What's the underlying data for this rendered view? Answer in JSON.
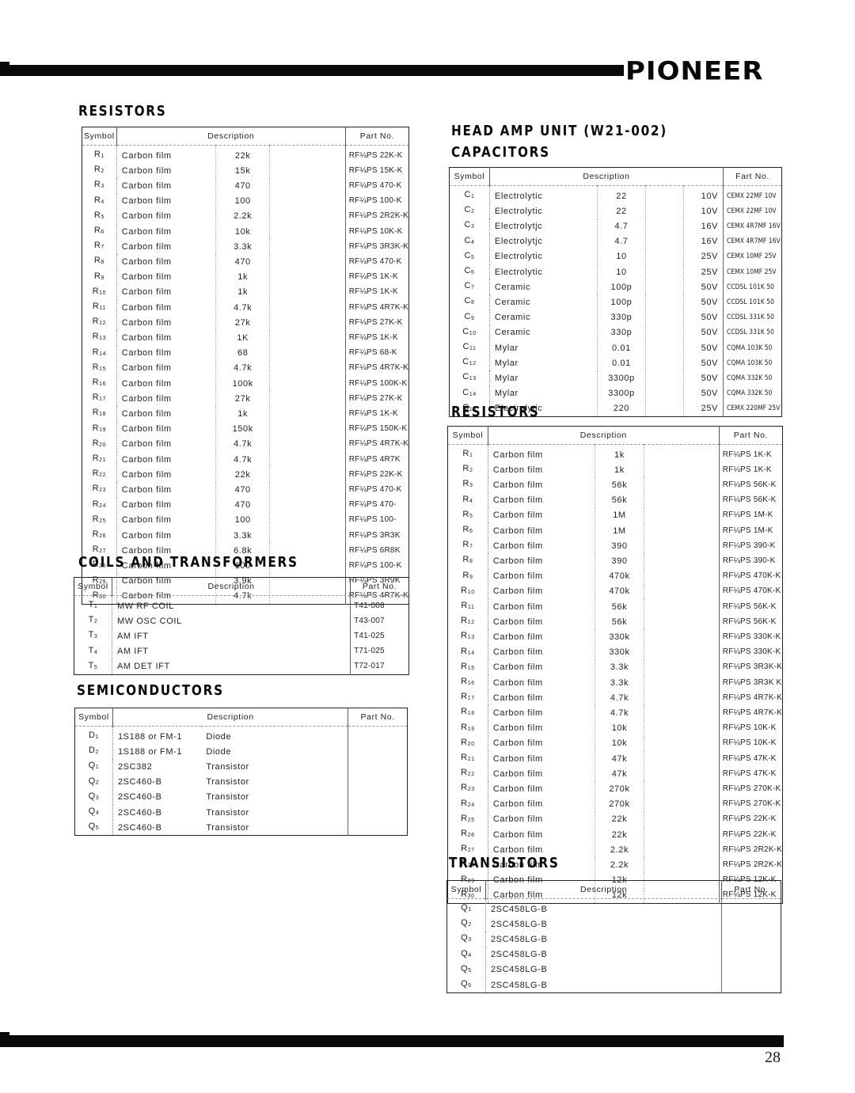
{
  "header": {
    "brand": "PIONEER"
  },
  "footer": {
    "page_number": "28"
  },
  "left": {
    "resistors": {
      "title": "RESISTORS",
      "columns": [
        "Symbol",
        "Description",
        "Part No."
      ],
      "rows": [
        {
          "sym": "R",
          "n": "1",
          "desc": "Carbon film",
          "val": "22k",
          "part": "RF¼PS 22K-K"
        },
        {
          "sym": "R",
          "n": "2",
          "desc": "Carbon film",
          "val": "15k",
          "part": "RF¼PS 15K-K"
        },
        {
          "sym": "R",
          "n": "3",
          "desc": "Carbon film",
          "val": "470",
          "part": "RF¼PS 470-K"
        },
        {
          "sym": "R",
          "n": "4",
          "desc": "Carbon film",
          "val": "100",
          "part": "RF¼PS 100-K"
        },
        {
          "sym": "R",
          "n": "5",
          "desc": "Carbon film",
          "val": "2.2k",
          "part": "RF¼PS 2R2K-K"
        },
        {
          "sym": "R",
          "n": "6",
          "desc": "Carbon film",
          "val": "10k",
          "part": "RF¼PS 10K-K"
        },
        {
          "sym": "R",
          "n": "7",
          "desc": "Carbon film",
          "val": "3.3k",
          "part": "RF¼PS 3R3K-K"
        },
        {
          "sym": "R",
          "n": "8",
          "desc": "Carbon film",
          "val": "470",
          "part": "RF¼PS 470-K"
        },
        {
          "sym": "R",
          "n": "9",
          "desc": "Carbon film",
          "val": "1k",
          "part": "RF¼PS 1K-K"
        },
        {
          "sym": "R",
          "n": "10",
          "desc": "Carbon film",
          "val": "1k",
          "part": "RF¼PS 1K-K"
        },
        {
          "sym": "R",
          "n": "11",
          "desc": "Carbon film",
          "val": "4.7k",
          "part": "RF¼PS 4R7K-K"
        },
        {
          "sym": "R",
          "n": "12",
          "desc": "Carbon film",
          "val": "27k",
          "part": "RF¼PS 27K-K"
        },
        {
          "sym": "R",
          "n": "13",
          "desc": "Carbon film",
          "val": "1K",
          "part": "RF¼PS 1K-K"
        },
        {
          "sym": "R",
          "n": "14",
          "desc": "Carbon film",
          "val": "68",
          "part": "RF¼PS 68-K"
        },
        {
          "sym": "R",
          "n": "15",
          "desc": "Carbon film",
          "val": "4.7k",
          "part": "RF¼PS 4R7K-K"
        },
        {
          "sym": "R",
          "n": "16",
          "desc": "Carbon film",
          "val": "100k",
          "part": "RF¼PS 100K-K"
        },
        {
          "sym": "R",
          "n": "17",
          "desc": "Carbon film",
          "val": "27k",
          "part": "RF¼PS 27K-K"
        },
        {
          "sym": "R",
          "n": "18",
          "desc": "Carbon film",
          "val": "1k",
          "part": "RF¼PS 1K-K"
        },
        {
          "sym": "R",
          "n": "19",
          "desc": "Carbon film",
          "val": "150k",
          "part": "RF¼PS 150K-K"
        },
        {
          "sym": "R",
          "n": "20",
          "desc": "Carbon film",
          "val": "4.7k",
          "part": "RF¼PS 4R7K-K"
        },
        {
          "sym": "R",
          "n": "21",
          "desc": "Carbon film",
          "val": "4.7k",
          "part": "RF¼PS 4R7K"
        },
        {
          "sym": "R",
          "n": "22",
          "desc": "Carbon film",
          "val": "22k",
          "part": "RF¼PS 22K-K"
        },
        {
          "sym": "R",
          "n": "23",
          "desc": "Carbon film",
          "val": "470",
          "part": "RF¼PS 470-K"
        },
        {
          "sym": "R",
          "n": "24",
          "desc": "Carbon film",
          "val": "470",
          "part": "RF¼PS 470-"
        },
        {
          "sym": "R",
          "n": "25",
          "desc": "Carbon film",
          "val": "100",
          "part": "RF¼PS 100-"
        },
        {
          "sym": "R",
          "n": "26",
          "desc": "Carbon film",
          "val": "3.3k",
          "part": "RF¼PS 3R3K"
        },
        {
          "sym": "R",
          "n": "27",
          "desc": "Carbon film",
          "val": "6.8k",
          "part": "RF¼PS 6R8K"
        },
        {
          "sym": "R",
          "n": "28",
          "desc": "Carbon film",
          "val": "100",
          "part": "RF¼PS 100-K"
        },
        {
          "sym": "R",
          "n": "29",
          "desc": "Carbon film",
          "val": "3.9k",
          "part": "RF¼PS 3R9K"
        },
        {
          "sym": "R",
          "n": "30",
          "desc": "Carbon film",
          "val": "4.7k",
          "part": "RF¼PS 4R7K-K"
        }
      ]
    },
    "coils": {
      "title": "COILS AND TRANSFORMERS",
      "columns": [
        "Symbol",
        "Description",
        "Part No."
      ],
      "rows": [
        {
          "sym": "T",
          "n": "1",
          "desc": "MW RF COIL",
          "part": "T41-008"
        },
        {
          "sym": "T",
          "n": "2",
          "desc": "MW OSC COIL",
          "part": "T43-007"
        },
        {
          "sym": "T",
          "n": "3",
          "desc": "AM IFT",
          "part": "T41-025"
        },
        {
          "sym": "T",
          "n": "4",
          "desc": "AM IFT",
          "part": "T71-025"
        },
        {
          "sym": "T",
          "n": "5",
          "desc": "AM DET IFT",
          "part": "T72-017"
        }
      ]
    },
    "semiconductors": {
      "title": "SEMICONDUCTORS",
      "columns": [
        "Symbol",
        "Description",
        "Part No."
      ],
      "rows": [
        {
          "sym": "D",
          "n": "1",
          "desc": "1S188 or FM-1",
          "type": "Diode",
          "part": ""
        },
        {
          "sym": "D",
          "n": "2",
          "desc": "1S188 or FM-1",
          "type": "Diode",
          "part": ""
        },
        {
          "sym": "Q",
          "n": "1",
          "desc": "2SC382",
          "type": "Transistor",
          "part": ""
        },
        {
          "sym": "Q",
          "n": "2",
          "desc": "2SC460-B",
          "type": "Transistor",
          "part": ""
        },
        {
          "sym": "Q",
          "n": "3",
          "desc": "2SC460-B",
          "type": "Transistor",
          "part": ""
        },
        {
          "sym": "Q",
          "n": "4",
          "desc": "2SC460-B",
          "type": "Transistor",
          "part": ""
        },
        {
          "sym": "Q",
          "n": "5",
          "desc": "2SC460-B",
          "type": "Transistor",
          "part": ""
        }
      ]
    }
  },
  "right": {
    "unit_title": "HEAD AMP UNIT (W21-002)",
    "capacitors": {
      "title": "CAPACITORS",
      "columns": [
        "Symbol",
        "Description",
        "Fart No."
      ],
      "rows": [
        {
          "sym": "C",
          "n": "1",
          "desc": "Electrolytic",
          "val": "22",
          "volt": "10V",
          "part": "CEMX 22MF 10V"
        },
        {
          "sym": "C",
          "n": "2",
          "desc": "Electrolytic",
          "val": "22",
          "volt": "10V",
          "part": "CEMX 22MF 10V"
        },
        {
          "sym": "C",
          "n": "3",
          "desc": "Electrolytjc",
          "val": "4.7",
          "volt": "16V",
          "part": "CEMX 4R7MF 16V"
        },
        {
          "sym": "C",
          "n": "4",
          "desc": "Electrolytjc",
          "val": "4.7",
          "volt": "16V",
          "part": "CEMX 4R7MF 16V"
        },
        {
          "sym": "C",
          "n": "5",
          "desc": "Electrolytic",
          "val": "10",
          "volt": "25V",
          "part": "CEMX 10MF 25V"
        },
        {
          "sym": "C",
          "n": "6",
          "desc": "Electrolytic",
          "val": "10",
          "volt": "25V",
          "part": "CEMX 10MF 25V"
        },
        {
          "sym": "C",
          "n": "7",
          "desc": "Ceramic",
          "val": "100p",
          "volt": "50V",
          "part": "CCDSL 101K 50"
        },
        {
          "sym": "C",
          "n": "8",
          "desc": "Ceramic",
          "val": "100p",
          "volt": "50V",
          "part": "CCDSL 101K 50"
        },
        {
          "sym": "C",
          "n": "9",
          "desc": "Ceramic",
          "val": "330p",
          "volt": "50V",
          "part": "CCDSL 331K 50"
        },
        {
          "sym": "C",
          "n": "10",
          "desc": "Ceramic",
          "val": "330p",
          "volt": "50V",
          "part": "CCDSL 331K 50"
        },
        {
          "sym": "C",
          "n": "11",
          "desc": "Mylar",
          "val": "0.01",
          "volt": "50V",
          "part": "CQMA 103K 50"
        },
        {
          "sym": "C",
          "n": "12",
          "desc": "Mylar",
          "val": "0.01",
          "volt": "50V",
          "part": "CQMA 103K 50"
        },
        {
          "sym": "C",
          "n": "13",
          "desc": "Mylar",
          "val": "3300p",
          "volt": "50V",
          "part": "CQMA 332K 50"
        },
        {
          "sym": "C",
          "n": "14",
          "desc": "Mylar",
          "val": "3300p",
          "volt": "50V",
          "part": "CQMA 332K 50"
        },
        {
          "sym": "C",
          "n": "15",
          "desc": "Electrolytic",
          "val": "220",
          "volt": "25V",
          "part": "CEMX 220MF 25V"
        }
      ]
    },
    "resistors": {
      "title": "RESISTORS",
      "columns": [
        "Symbol",
        "Description",
        "Part No."
      ],
      "rows": [
        {
          "sym": "R",
          "n": "1",
          "desc": "Carbon film",
          "val": "1k",
          "part": "RF¼PS 1K-K"
        },
        {
          "sym": "R",
          "n": "2",
          "desc": "Carbon film",
          "val": "1k",
          "part": "RF¼PS 1K-K"
        },
        {
          "sym": "R",
          "n": "3",
          "desc": "Carbon film",
          "val": "56k",
          "part": "RF¼PS 56K-K"
        },
        {
          "sym": "R",
          "n": "4",
          "desc": "Carbon film",
          "val": "56k",
          "part": "RF¼PS 56K-K"
        },
        {
          "sym": "R",
          "n": "5",
          "desc": "Carbon film",
          "val": "1M",
          "part": "RF¼PS 1M-K"
        },
        {
          "sym": "R",
          "n": "6",
          "desc": "Carbon film",
          "val": "1M",
          "part": "RF¼PS 1M-K"
        },
        {
          "sym": "R",
          "n": "7",
          "desc": "Carbon film",
          "val": "390",
          "part": "RF¼PS 390-K"
        },
        {
          "sym": "R",
          "n": "8",
          "desc": "Carbon film",
          "val": "390",
          "part": "RF¼PS 390-K"
        },
        {
          "sym": "R",
          "n": "9",
          "desc": "Carbon film",
          "val": "470k",
          "part": "RF¼PS 470K-K"
        },
        {
          "sym": "R",
          "n": "10",
          "desc": "Carbon film",
          "val": "470k",
          "part": "RF¼PS 470K-K"
        },
        {
          "sym": "R",
          "n": "11",
          "desc": "Carbon film",
          "val": "56k",
          "part": "RF¼PS 56K-K"
        },
        {
          "sym": "R",
          "n": "12",
          "desc": "Carbon film",
          "val": "56k",
          "part": "RF¼PS 56K-K"
        },
        {
          "sym": "R",
          "n": "13",
          "desc": "Carbon film",
          "val": "330k",
          "part": "RF¼PS 330K-K"
        },
        {
          "sym": "R",
          "n": "14",
          "desc": "Carbon film",
          "val": "330k",
          "part": "RF¼PS 330K-K"
        },
        {
          "sym": "R",
          "n": "15",
          "desc": "Carbon film",
          "val": "3.3k",
          "part": "RF¼PS 3R3K-K"
        },
        {
          "sym": "R",
          "n": "16",
          "desc": "Carbon film",
          "val": "3.3k",
          "part": "RF¼PS 3R3K K"
        },
        {
          "sym": "R",
          "n": "17",
          "desc": "Carbon film",
          "val": "4.7k",
          "part": "RF¼PS 4R7K-K"
        },
        {
          "sym": "R",
          "n": "18",
          "desc": "Carbon film",
          "val": "4.7k",
          "part": "RF¼PS 4R7K-K"
        },
        {
          "sym": "R",
          "n": "19",
          "desc": "Carbon film",
          "val": "10k",
          "part": "RF¼PS 10K-K"
        },
        {
          "sym": "R",
          "n": "20",
          "desc": "Carbon film",
          "val": "10k",
          "part": "RF¼PS 10K-K"
        },
        {
          "sym": "R",
          "n": "21",
          "desc": "Carbon film",
          "val": "47k",
          "part": "RF¼PS 47K-K"
        },
        {
          "sym": "R",
          "n": "22",
          "desc": "Carbon film",
          "val": "47k",
          "part": "RF¼PS 47K-K"
        },
        {
          "sym": "R",
          "n": "23",
          "desc": "Carbon film",
          "val": "270k",
          "part": "RF¼PS 270K-K"
        },
        {
          "sym": "R",
          "n": "24",
          "desc": "Carbon film",
          "val": "270k",
          "part": "RF¼PS 270K-K"
        },
        {
          "sym": "R",
          "n": "25",
          "desc": "Carbon film",
          "val": "22k",
          "part": "RF¼PS 22K-K"
        },
        {
          "sym": "R",
          "n": "26",
          "desc": "Carbon film",
          "val": "22k",
          "part": "RF¼PS 22K-K"
        },
        {
          "sym": "R",
          "n": "27",
          "desc": "Carbon film",
          "val": "2.2k",
          "part": "RF¼PS 2R2K-K"
        },
        {
          "sym": "R",
          "n": "28",
          "desc": "Carbon film",
          "val": "2.2k",
          "part": "RF¼PS 2R2K-K"
        },
        {
          "sym": "R",
          "n": "29",
          "desc": "Carbon film",
          "val": "12k",
          "part": "RF¼PS 12K-K"
        },
        {
          "sym": "R",
          "n": "30",
          "desc": "Carbon film",
          "val": "12k",
          "part": "RF¼PS 12K-K"
        }
      ]
    },
    "transistors": {
      "title": "TRANSISTORS",
      "columns": [
        "Symbol",
        "Description",
        "Part No."
      ],
      "rows": [
        {
          "sym": "Q",
          "n": "1",
          "desc": "2SC458LG-B",
          "part": ""
        },
        {
          "sym": "Q",
          "n": "2",
          "desc": "2SC458LG-B",
          "part": ""
        },
        {
          "sym": "Q",
          "n": "3",
          "desc": "2SC458LG-B",
          "part": ""
        },
        {
          "sym": "Q",
          "n": "4",
          "desc": "2SC458LG-B",
          "part": ""
        },
        {
          "sym": "Q",
          "n": "5",
          "desc": "2SC458LG-B",
          "part": ""
        },
        {
          "sym": "Q",
          "n": "6",
          "desc": "2SC458LG-B",
          "part": ""
        }
      ]
    }
  }
}
